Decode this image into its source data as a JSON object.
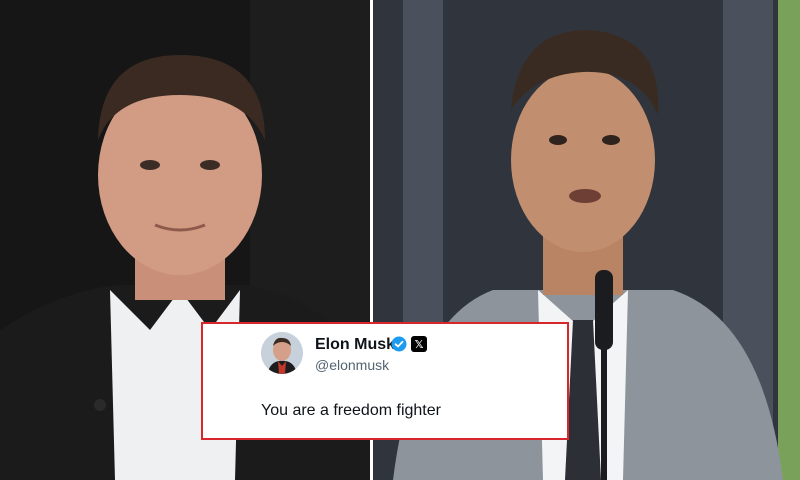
{
  "tweet": {
    "author_name": "Elon Musk",
    "handle": "@elonmusk",
    "text": "You are a freedom fighter",
    "verified_icon": "verified-badge-icon",
    "platform_icon": "x-logo-icon",
    "border_color": "#d8262b"
  },
  "photos": {
    "left": "portrait-photo",
    "right": "speaker-photo"
  }
}
